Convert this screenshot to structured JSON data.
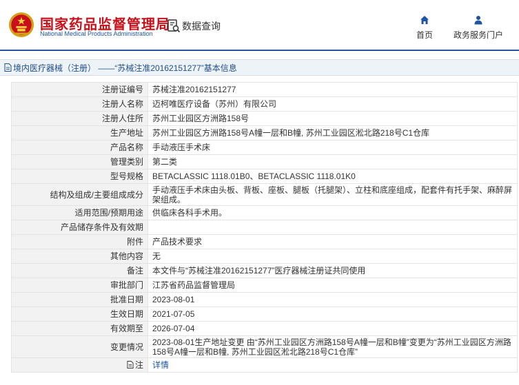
{
  "header": {
    "title": "国家药品监督管理局",
    "subtitle": "National Medical Products Administration",
    "query_label": "数据查询",
    "nav": [
      {
        "label": "首页",
        "icon": "home-icon"
      },
      {
        "label": "政务服务门户",
        "icon": "user-icon"
      }
    ]
  },
  "breadcrumb": {
    "text": "境内医疗器械（注册） ——“苏械注准20162151277”基本信息"
  },
  "fields": [
    {
      "label": "注册证编号",
      "value": "苏械注准20162151277"
    },
    {
      "label": "注册人名称",
      "value": "迈柯唯医疗设备（苏州）有限公司"
    },
    {
      "label": "注册人住所",
      "value": "苏州工业园区方洲路158号"
    },
    {
      "label": "生产地址",
      "value": "苏州工业园区方洲路158号A幢一层和B幢, 苏州工业园区淞北路218号C1仓库"
    },
    {
      "label": "产品名称",
      "value": "手动液压手术床"
    },
    {
      "label": "管理类别",
      "value": "第二类"
    },
    {
      "label": "型号规格",
      "value": "BETACLASSIC 1118.01B0、BETACLASSIC 1118.01K0"
    },
    {
      "label": "结构及组成/主要组成成分",
      "value": "手动液压手术床由头板、背板、座板、腿板（托腿架）、立柱和底座组成，配套件有托手架、麻醉屏架组成。"
    },
    {
      "label": "适用范围/预期用途",
      "value": "供临床各科手术用。"
    },
    {
      "label": "产品储存条件及有效期",
      "value": ""
    },
    {
      "label": "附件",
      "value": "产品技术要求"
    },
    {
      "label": "其他内容",
      "value": "无"
    },
    {
      "label": "备注",
      "value": "本文件与“苏械注准20162151277”医疗器械注册证共同使用"
    },
    {
      "label": "审批部门",
      "value": "江苏省药品监督管理局"
    },
    {
      "label": "批准日期",
      "value": "2023-08-01"
    },
    {
      "label": "生效日期",
      "value": "2021-07-05"
    },
    {
      "label": "有效期至",
      "value": "2026-07-04"
    },
    {
      "label": "变更情况",
      "value": "2023-08-01生产地址变更 由“苏州工业园区方洲路158号A幢一层和B幢”变更为“苏州工业园区方洲路158号A幢一层和B幢, 苏州工业园区淞北路218号C1仓库”"
    }
  ],
  "note": {
    "label": "注",
    "link_text": "详情"
  },
  "colors": {
    "brand_red": "#c8101a",
    "brand_blue": "#1f55a3",
    "label_bg": "#f2f2f2"
  }
}
